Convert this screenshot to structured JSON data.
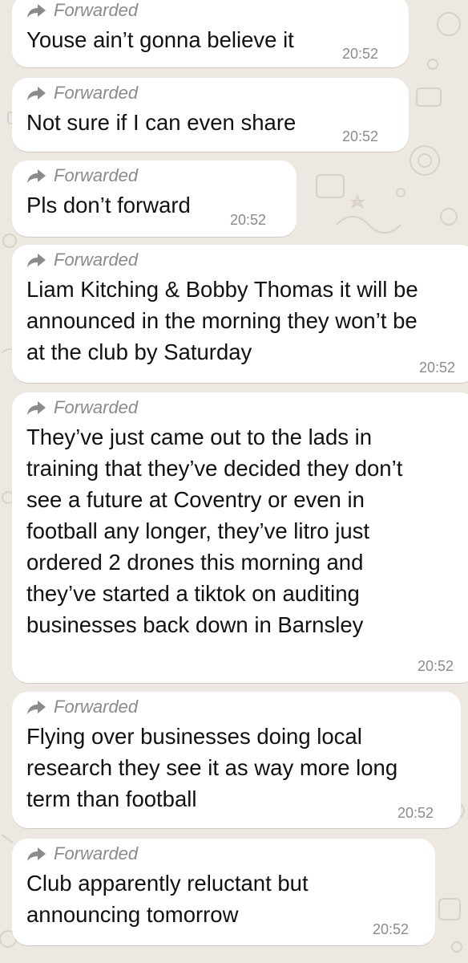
{
  "chat": {
    "forwarded_label": "Forwarded",
    "messages": [
      {
        "lines": [
          "Youse ain’t gonna believe it"
        ],
        "time": "20:52"
      },
      {
        "lines": [
          "Not sure if I can even share"
        ],
        "time": "20:52"
      },
      {
        "lines": [
          "Pls don’t forward"
        ],
        "time": "20:52"
      },
      {
        "lines": [
          "Liam Kitching & Bobby Thomas it will be",
          "announced in the morning they won’t be",
          "at the club by Saturday"
        ],
        "time": "20:52"
      },
      {
        "lines": [
          "They’ve just came out to the lads in",
          "training that they’ve decided they don’t",
          "see a future at Coventry or even in",
          "football any longer, they’ve litro just",
          "ordered 2 drones this morning and",
          "they’ve started a tiktok on auditing",
          "businesses back down in Barnsley"
        ],
        "time": "20:52"
      },
      {
        "lines": [
          "Flying over businesses doing local",
          "research they see it as way more long",
          "term than football"
        ],
        "time": "20:52"
      },
      {
        "lines": [
          "Club apparently reluctant but",
          "announcing tomorrow"
        ],
        "time": "20:52"
      }
    ]
  },
  "colors": {
    "background": "#ede8e1",
    "bubble": "#ffffff",
    "text": "#111111",
    "meta": "#8a8a8f"
  },
  "icons": {
    "forwarded": "forward-arrow-icon"
  }
}
